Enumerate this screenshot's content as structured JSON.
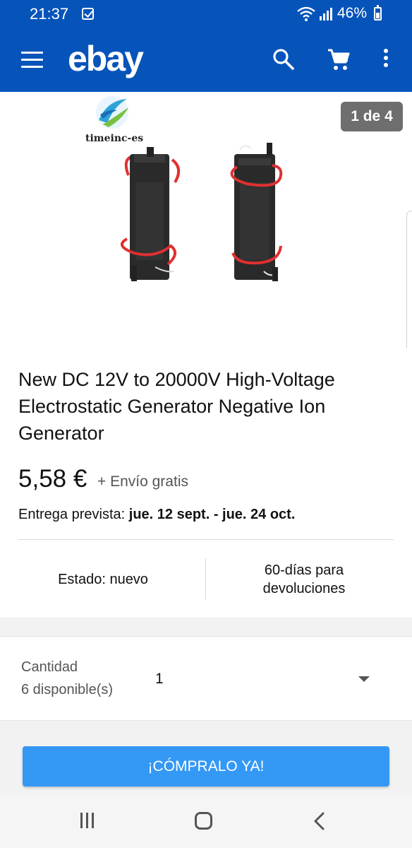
{
  "status_bar": {
    "time": "21:37",
    "battery_percent": "46%",
    "icons": [
      "checkbox-notification-icon",
      "wifi-icon",
      "signal-icon",
      "battery-icon"
    ]
  },
  "app_bar": {
    "logo": "ebay",
    "color": "#0654ba",
    "icons": [
      "menu-icon",
      "search-icon",
      "cart-icon",
      "more-vert-icon"
    ]
  },
  "gallery": {
    "counter": "1 de 4",
    "seller_logo_text": "timeinc-es"
  },
  "product": {
    "title": "New DC 12V to 20000V High-Voltage Electrostatic Generator Negative Ion Generator",
    "price": "5,58 €",
    "shipping": "+ Envío gratis",
    "delivery_label": "Entrega prevista:",
    "delivery_dates": "jue. 12 sept. - jue. 24 oct.",
    "condition": "Estado: nuevo",
    "returns_line1": "60-días para",
    "returns_line2": "devoluciones"
  },
  "quantity": {
    "label": "Cantidad",
    "available": "6 disponible(s)",
    "value": "1"
  },
  "buy_button": {
    "label": "¡CÓMPRALO YA!",
    "color": "#3498f5"
  },
  "nav_bar": {
    "icons": [
      "recents-icon",
      "home-icon",
      "back-icon"
    ]
  }
}
